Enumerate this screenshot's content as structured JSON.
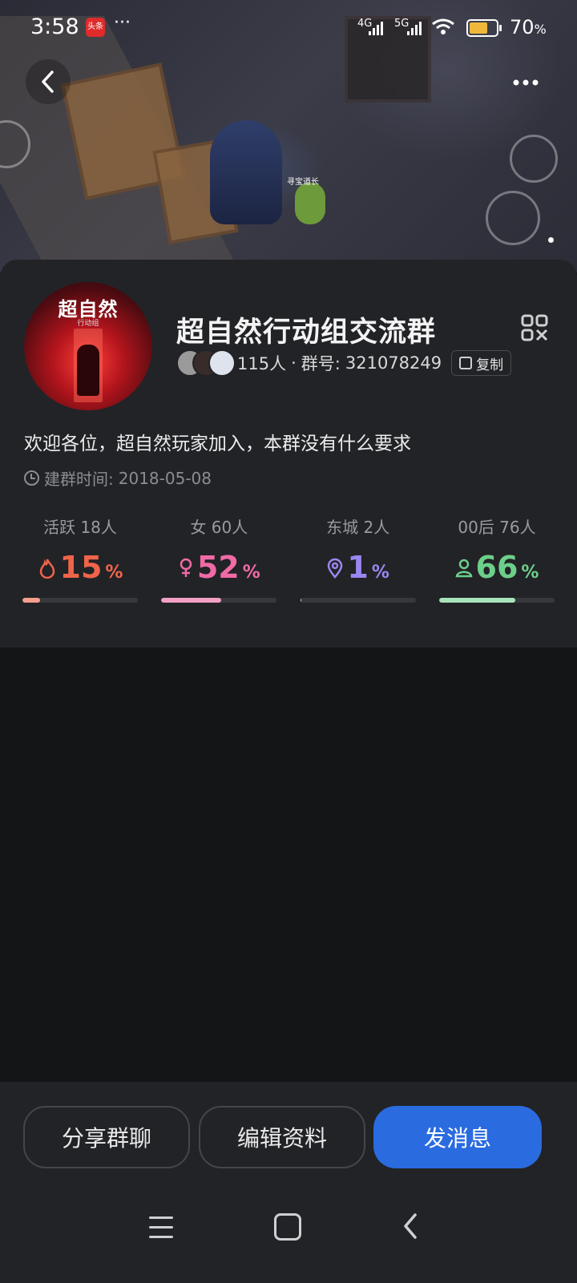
{
  "status_bar": {
    "time": "3:58",
    "news_badge": "头条",
    "more_dots": "···",
    "net1": "4G",
    "net2": "5G",
    "battery": "70",
    "battery_unit": "%",
    "battery_level": 0.7,
    "battery_color": "#f0b83a"
  },
  "hero": {
    "game_tag": "寻宝道长"
  },
  "group": {
    "avatar_logo": "超自然",
    "avatar_logo_sub": "行动组",
    "name": "超自然行动组交流群",
    "members": "115人",
    "separator": "·",
    "id_label": "群号:",
    "id_value": "321078249",
    "copy_label": "复制",
    "description": "欢迎各位，超自然玩家加入，本群没有什么要求",
    "created_label": "建群时间:",
    "created_date": "2018-05-08"
  },
  "stats": [
    {
      "label": "活跃 18人",
      "value": "15",
      "unit": "%",
      "icon": "flame-icon",
      "color": "#f0644a",
      "bar_color": "#f3a08c",
      "fraction": 0.15
    },
    {
      "label": "女 60人",
      "value": "52",
      "unit": "%",
      "icon": "female-icon",
      "color": "#f06aa6",
      "bar_color": "#f2a0c4",
      "fraction": 0.52
    },
    {
      "label": "东城 2人",
      "value": "1",
      "unit": "%",
      "icon": "location-pin-icon",
      "color": "#9a86f0",
      "bar_color": "#d6d6d8",
      "fraction": 0.01
    },
    {
      "label": "00后 76人",
      "value": "66",
      "unit": "%",
      "icon": "person-icon",
      "color": "#6ccf8a",
      "bar_color": "#a8e3bb",
      "fraction": 0.66
    }
  ],
  "actions": {
    "share": "分享群聊",
    "edit": "编辑资料",
    "send": "发消息"
  },
  "colors": {
    "primary": "#2a6be0",
    "panel": "#222326",
    "background": "#141517"
  }
}
